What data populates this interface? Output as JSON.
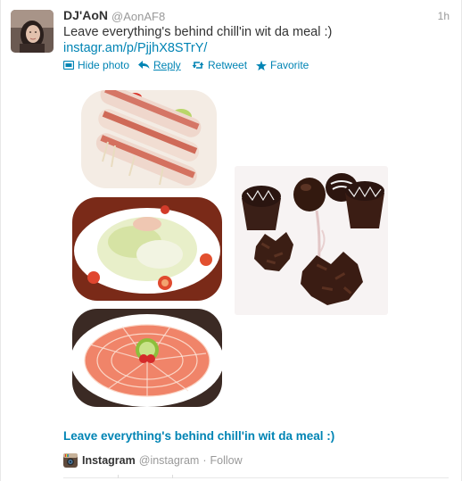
{
  "tweet": {
    "display_name": "DJ'AoN",
    "handle": "@AonAF8",
    "time": "1h",
    "text": "Leave everything's behind chill'in wit da meal :)",
    "link": "instagr.am/p/PjjhX8STrY/"
  },
  "actions": {
    "hide_photo": "Hide photo",
    "reply": "Reply",
    "retweet": "Retweet",
    "favorite": "Favorite"
  },
  "card": {
    "title": "Leave everything's behind chill'in wit da meal :)"
  },
  "attribution": {
    "name": "Instagram",
    "handle": "@instagram",
    "separator": "·",
    "follow": "Follow"
  },
  "colors": {
    "link": "#0084b4",
    "text": "#333333",
    "muted": "#999999"
  },
  "icons": {
    "hide_photo": "photo-icon",
    "reply": "reply-arrow-icon",
    "retweet": "retweet-icon",
    "favorite": "star-icon",
    "attribution": "instagram-camera-icon"
  }
}
